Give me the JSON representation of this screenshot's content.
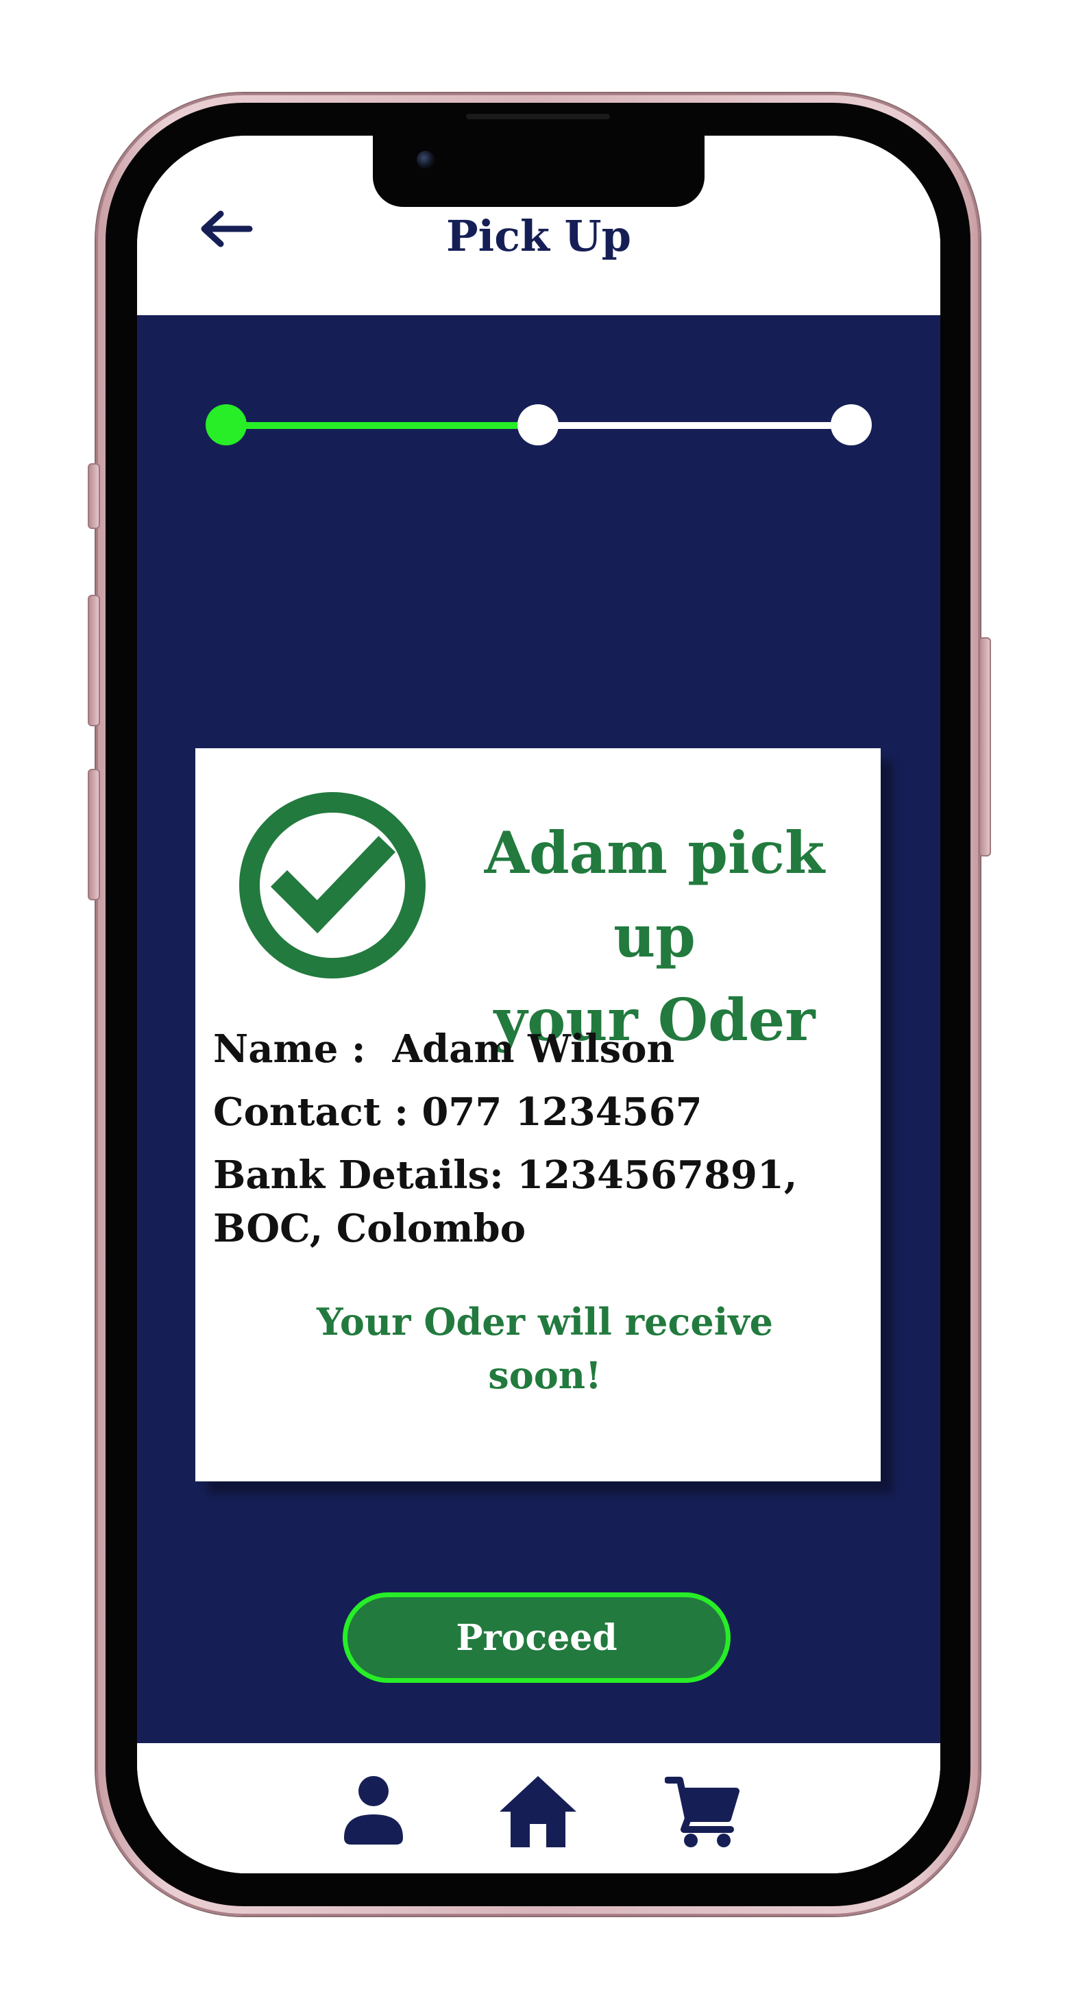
{
  "header": {
    "title": "Pick Up",
    "back_icon": "arrow-left-icon"
  },
  "stepper": {
    "total_steps": 3,
    "current_step": 1
  },
  "card": {
    "icon": "check-circle-icon",
    "headline_line1": "Adam pick up",
    "headline_line2": "your Oder",
    "details": [
      {
        "label": "Name :",
        "value": "Adam Wilson"
      },
      {
        "label": "Contact :",
        "value": "077 1234567"
      },
      {
        "label": "Bank Details:",
        "value": "1234567891, BOC, Colombo"
      }
    ],
    "notice_line1": "Your Oder will receive",
    "notice_line2": "soon!"
  },
  "actions": {
    "proceed_label": "Proceed"
  },
  "bottom_nav": {
    "items": [
      {
        "icon": "user-icon",
        "name": "profile"
      },
      {
        "icon": "home-icon",
        "name": "home"
      },
      {
        "icon": "cart-icon",
        "name": "cart"
      }
    ]
  },
  "colors": {
    "navy": "#161f55",
    "accent_green": "#27ee27",
    "dark_green": "#227a3e"
  }
}
